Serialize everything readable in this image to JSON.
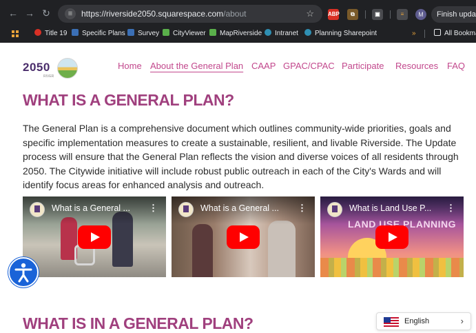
{
  "browser": {
    "url_host": "https://riverside2050.squarespace.com",
    "url_path": "/about",
    "profile_initial": "M",
    "finish_update_label": "Finish update",
    "bookmarks": [
      "Title 19",
      "Specific Plans",
      "Survey",
      "CityViewer",
      "MapRiverside",
      "Intranet",
      "Planning Sharepoint"
    ],
    "overflow": "»",
    "all_bookmarks": "All Bookma",
    "ext_abp": "ABP"
  },
  "site": {
    "logo_text": "2050",
    "logo_sub": "RIVER",
    "nav": [
      "Home",
      "About the General Plan",
      "CAAP",
      "GPAC/CPAC",
      "Participate",
      "Resources",
      "FAQ"
    ],
    "active_nav_index": 1
  },
  "main": {
    "heading": "WHAT IS A GENERAL PLAN?",
    "paragraph": "The General Plan is a comprehensive document which outlines community-wide priorities, goals and specific implementation measures to create a sustainable, resilient, and livable Riverside. The Update process will ensure that the General Plan reflects the vision and diverse voices of all residents through 2050. The Citywide initiative will include robust public outreach in each of the City's Wards and will identify focus areas for enhanced analysis and outreach.",
    "videos": [
      {
        "title": "What is a General ..."
      },
      {
        "title": "What is a General ..."
      },
      {
        "title": "What is Land Use P...",
        "overlay": "LAND USE PLANNING"
      }
    ],
    "menu_glyph": "⋮",
    "heading2": "WHAT IS IN A GENERAL PLAN?"
  },
  "language": {
    "label": "English",
    "chevron": "›"
  }
}
